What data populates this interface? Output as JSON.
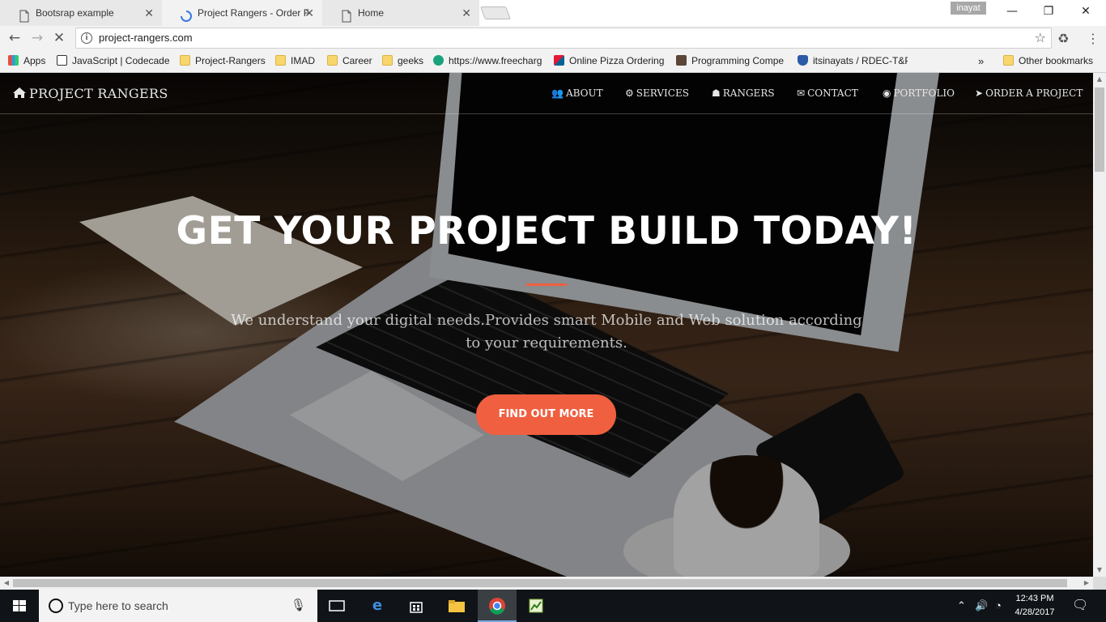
{
  "tabs": [
    {
      "title": "Bootsrap example",
      "icon": "document-icon"
    },
    {
      "title": "Project Rangers - Order F",
      "icon": "loading-spinner-icon"
    },
    {
      "title": "Home",
      "icon": "document-icon"
    }
  ],
  "window": {
    "profile": "inayat",
    "minimize": "—",
    "restore": "❐",
    "close": "✕"
  },
  "address": {
    "url": "project-rangers.com"
  },
  "bookmarks": [
    {
      "label": "Apps"
    },
    {
      "label": "JavaScript | Codecade"
    },
    {
      "label": "Project-Rangers"
    },
    {
      "label": "IMAD"
    },
    {
      "label": "Career"
    },
    {
      "label": "geeks"
    },
    {
      "label": "https://www.freecharg"
    },
    {
      "label": "Online Pizza Ordering"
    },
    {
      "label": "Programming Compe"
    },
    {
      "label": "itsinayats / RDEC-T&P"
    }
  ],
  "bookmarks_overflow": "»",
  "other_bookmarks": "Other bookmarks",
  "site": {
    "brand": "PROJECT RANGERS",
    "nav": [
      {
        "label": "ABOUT"
      },
      {
        "label": "SERVICES"
      },
      {
        "label": "RANGERS"
      },
      {
        "label": "CONTACT"
      },
      {
        "label": "PORTFOLIO"
      },
      {
        "label": "ORDER A PROJECT"
      }
    ],
    "hero_title": "GET YOUR PROJECT BUILD TODAY!",
    "hero_subtitle": "We understand your digital needs.Provides smart Mobile and Web solution according to your requirements.",
    "cta": "FIND OUT MORE",
    "accent_color": "#f05f40"
  },
  "taskbar": {
    "search_placeholder": "Type here to search",
    "time": "12:43 PM",
    "date": "4/28/2017"
  }
}
